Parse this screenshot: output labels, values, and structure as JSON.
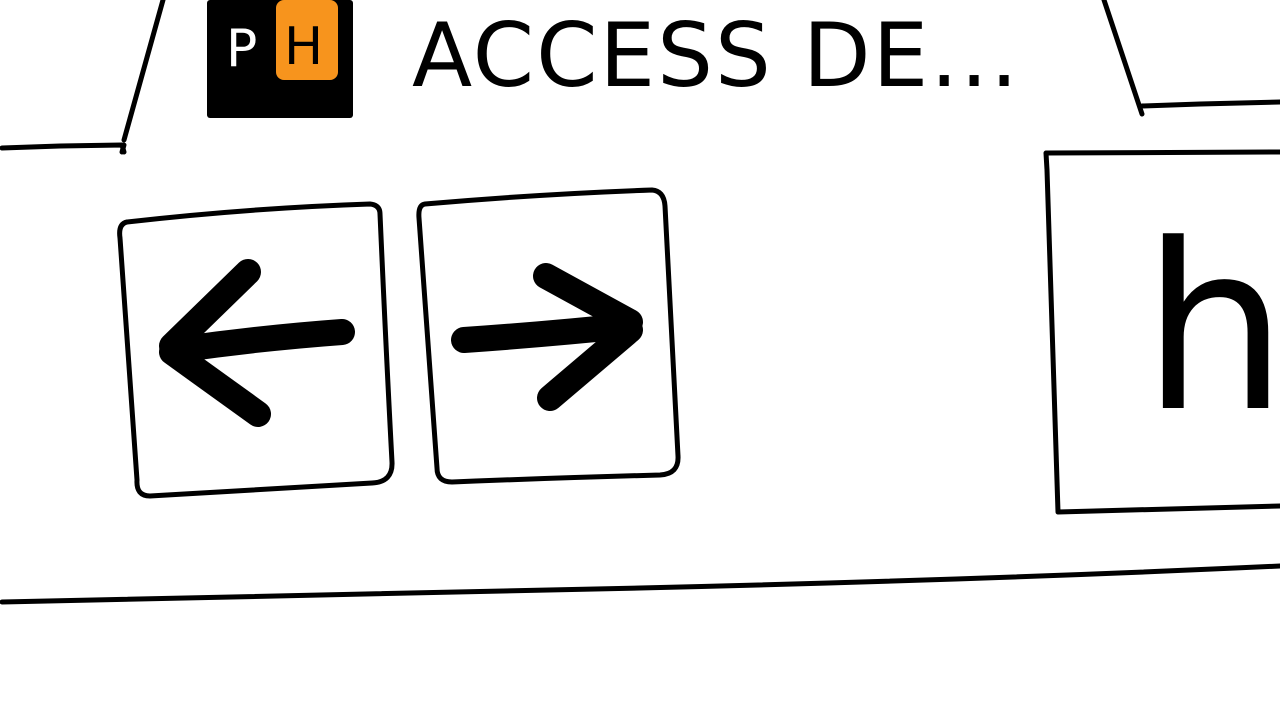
{
  "tab": {
    "logo": {
      "left_letter": "P",
      "right_letter": "H",
      "badge_color": "#000000",
      "left_letter_color": "#ffffff",
      "accent_color": "#f7941d",
      "right_letter_color": "#000000"
    },
    "title": "ACCESS DE..."
  },
  "toolbar": {
    "back_icon": "arrow-left-icon",
    "forward_icon": "arrow-right-icon"
  },
  "address_bar": {
    "value": "ht"
  },
  "colors": {
    "ink": "#000000",
    "background": "#ffffff",
    "accent": "#f7941d"
  }
}
